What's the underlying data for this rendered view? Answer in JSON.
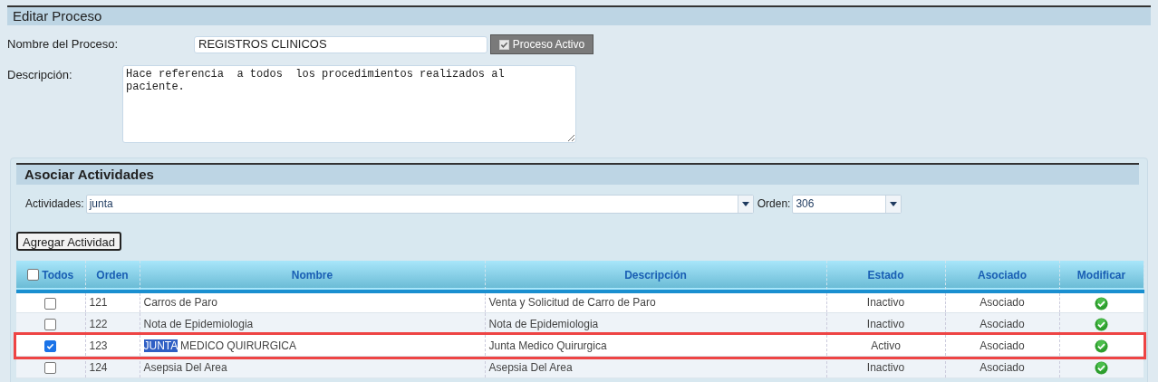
{
  "edit_section": {
    "title": "Editar Proceso"
  },
  "process_name": {
    "label": "Nombre del Proceso:",
    "value": "REGISTROS CLINICOS"
  },
  "active_toggle": {
    "label": "Proceso Activo",
    "checked": true
  },
  "description": {
    "label": "Descripción:",
    "value": "Hace referencia  a todos  los procedimientos realizados al\npaciente."
  },
  "associate_section": {
    "title": "Asociar Actividades"
  },
  "activities_field": {
    "label": "Actividades:",
    "value": "junta"
  },
  "order_field": {
    "label": "Orden:",
    "value": "306"
  },
  "add_button": "Agregar Actividad",
  "table": {
    "select_all": {
      "label": "Todos",
      "checked": false
    },
    "columns": [
      "Orden",
      "Nombre",
      "Descripción",
      "Estado",
      "Asociado",
      "Modificar"
    ],
    "rows": [
      {
        "checked": false,
        "highlighted": false,
        "order": "121",
        "name_parts": [
          {
            "text": "Carros de Paro",
            "selected": false
          }
        ],
        "description": "Venta y Solicitud de Carro de Paro",
        "status": "Inactivo",
        "associated": "Asociado"
      },
      {
        "checked": false,
        "highlighted": false,
        "order": "122",
        "name_parts": [
          {
            "text": "Nota de Epidemiologia",
            "selected": false
          }
        ],
        "description": "Nota de Epidemiologia",
        "status": "Inactivo",
        "associated": "Asociado"
      },
      {
        "checked": true,
        "highlighted": true,
        "order": "123",
        "name_parts": [
          {
            "text": "JUNTA",
            "selected": true
          },
          {
            "text": " MEDICO QUIRURGICA",
            "selected": false
          }
        ],
        "description": "Junta Medico Quirurgica",
        "status": "Activo",
        "associated": "Asociado"
      },
      {
        "checked": false,
        "highlighted": false,
        "order": "124",
        "name_parts": [
          {
            "text": "Asepsia Del Area",
            "selected": false
          }
        ],
        "description": "Asepsia Del Area",
        "status": "Inactivo",
        "associated": "Asociado"
      }
    ]
  }
}
